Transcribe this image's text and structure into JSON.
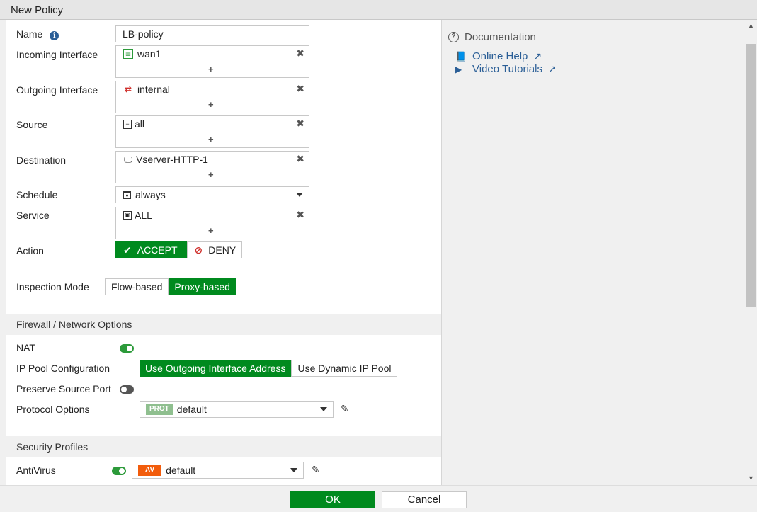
{
  "window": {
    "title": "New Policy"
  },
  "form": {
    "name": {
      "label": "Name",
      "value": "LB-policy"
    },
    "incoming": {
      "label": "Incoming Interface",
      "entry": "wan1",
      "add": "+",
      "remove": "✖"
    },
    "outgoing": {
      "label": "Outgoing Interface",
      "entry": "internal",
      "add": "+",
      "remove": "✖"
    },
    "source": {
      "label": "Source",
      "entry": "all",
      "add": "+",
      "remove": "✖"
    },
    "destination": {
      "label": "Destination",
      "entry": "Vserver-HTTP-1",
      "add": "+",
      "remove": "✖"
    },
    "schedule": {
      "label": "Schedule",
      "value": "always"
    },
    "service": {
      "label": "Service",
      "entry": "ALL",
      "add": "+",
      "remove": "✖"
    },
    "action": {
      "label": "Action",
      "accept": "ACCEPT",
      "deny": "DENY",
      "selected": "ACCEPT"
    },
    "inspection": {
      "label": "Inspection Mode",
      "flow": "Flow-based",
      "proxy": "Proxy-based",
      "selected": "Proxy-based"
    }
  },
  "firewall": {
    "title": "Firewall / Network Options",
    "nat": {
      "label": "NAT",
      "enabled": true
    },
    "ippool": {
      "label": "IP Pool Configuration",
      "option1": "Use Outgoing Interface Address",
      "option2": "Use Dynamic IP Pool",
      "selected": "Use Outgoing Interface Address"
    },
    "preserve": {
      "label": "Preserve Source Port",
      "enabled": false
    },
    "protocol": {
      "label": "Protocol Options",
      "tag": "PROT",
      "value": "default"
    }
  },
  "security": {
    "title": "Security Profiles",
    "antivirus": {
      "label": "AntiVirus",
      "enabled": true,
      "tag": "AV",
      "value": "default"
    }
  },
  "docs": {
    "title": "Documentation",
    "links": [
      {
        "label": "Online Help"
      },
      {
        "label": "Video Tutorials"
      }
    ]
  },
  "footer": {
    "ok": "OK",
    "cancel": "Cancel"
  },
  "colors": {
    "accent": "#008a1e",
    "link": "#2a5e96",
    "deny": "#d0312d",
    "prot_tag": "#8fbf8f",
    "av_tag": "#f25c0c"
  }
}
